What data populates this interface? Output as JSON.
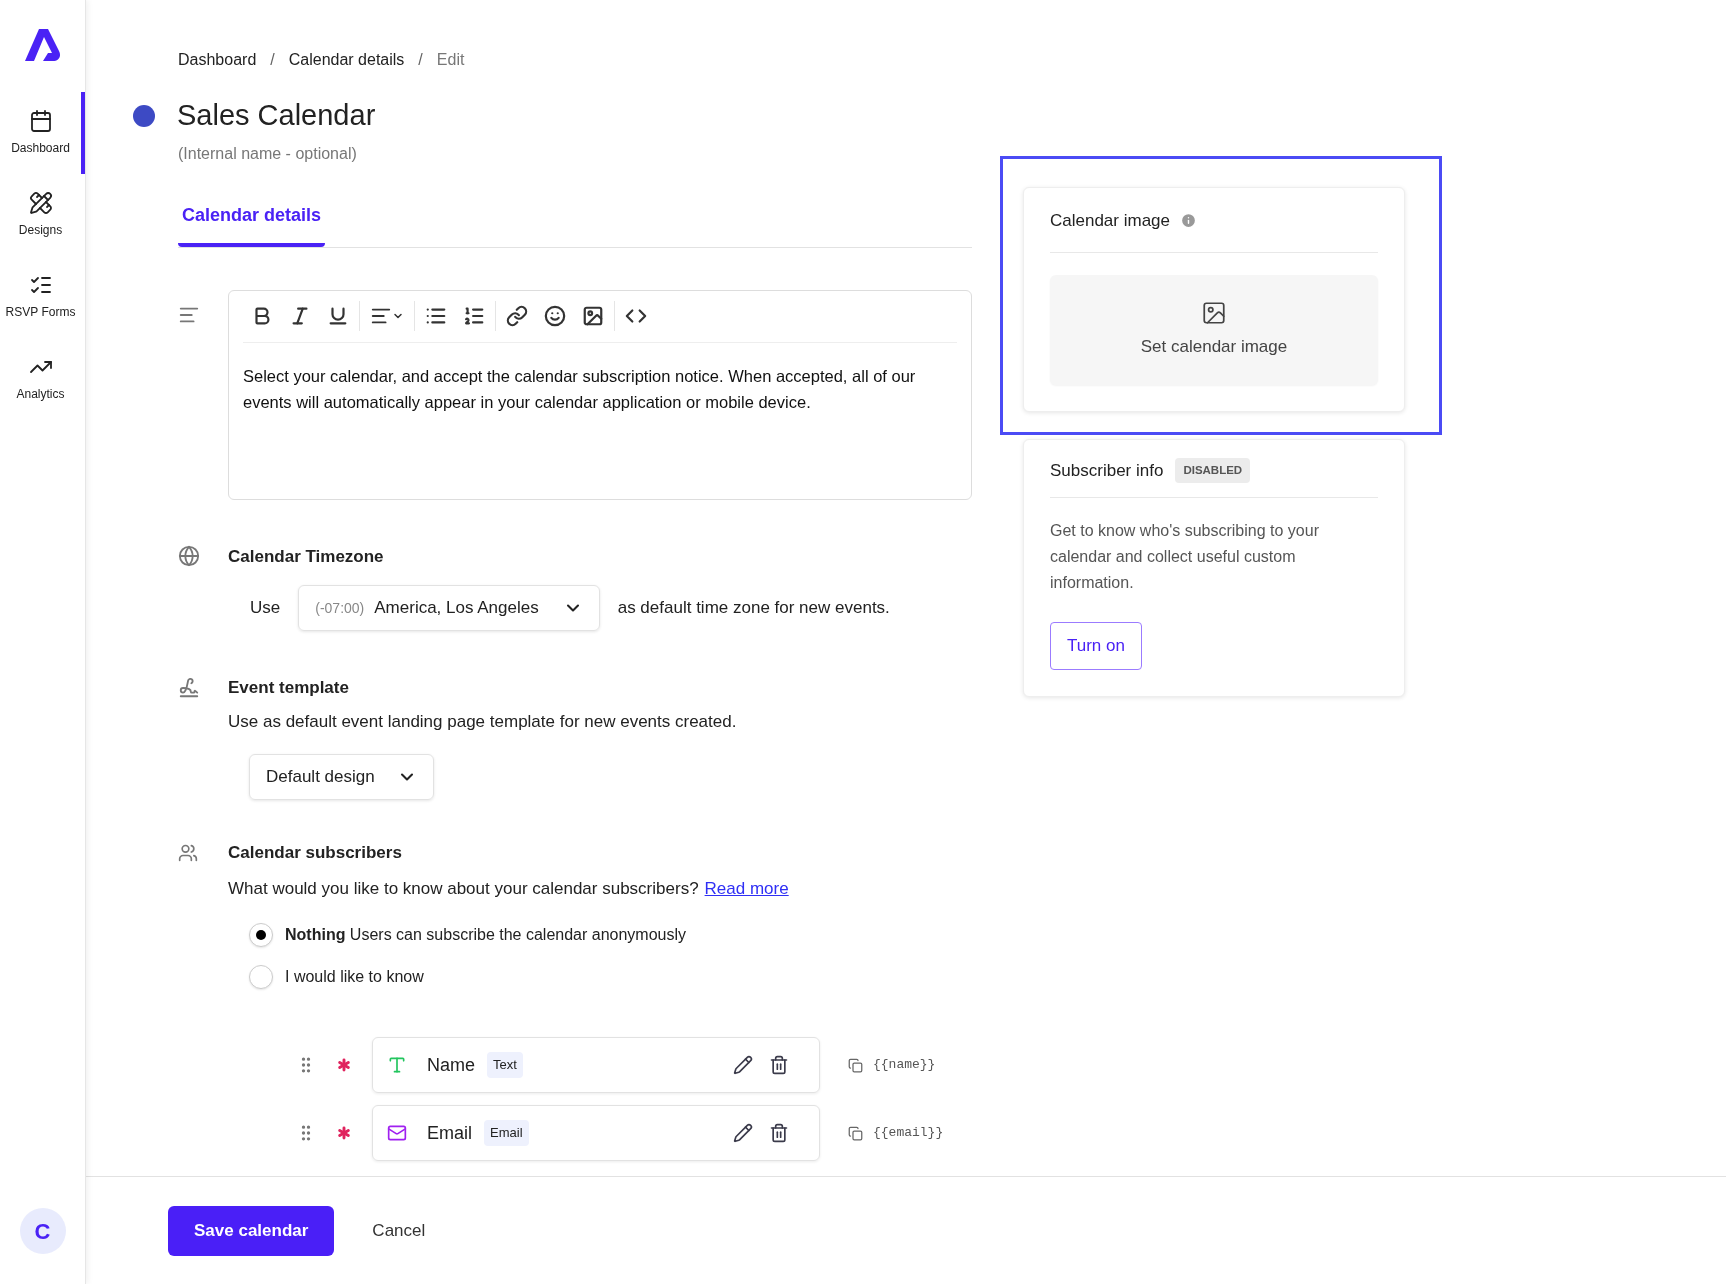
{
  "sidebar": {
    "items": [
      {
        "label": "Dashboard",
        "kind": "calendar",
        "selected": true
      },
      {
        "label": "Designs",
        "kind": "designs",
        "selected": false
      },
      {
        "label": "RSVP Forms",
        "kind": "forms",
        "selected": false
      },
      {
        "label": "Analytics",
        "kind": "analytics",
        "selected": false
      }
    ],
    "avatar": "C"
  },
  "breadcrumb": [
    {
      "label": "Dashboard",
      "current": false
    },
    {
      "label": "Calendar details",
      "current": false
    },
    {
      "label": "Edit",
      "current": true
    }
  ],
  "breadcrumb_separator": "/",
  "calendar": {
    "title": "Sales Calendar",
    "subtitle": "(Internal name - optional)",
    "color": "#3d4ac4"
  },
  "tabs": [
    {
      "label": "Calendar details",
      "selected": true
    }
  ],
  "editor": {
    "body": "Select your calendar, and accept the calendar subscription notice. When accepted, all of our events will automatically appear in your calendar application or mobile device."
  },
  "timezone": {
    "heading": "Calendar Timezone",
    "prefix": "Use",
    "offset": "(-07:00)",
    "value": "America, Los Angeles",
    "suffix": "as default time zone for new events."
  },
  "event_template": {
    "heading": "Event template",
    "description": "Use as default event landing page template for new events created.",
    "value": "Default design"
  },
  "subscribers": {
    "heading": "Calendar subscribers",
    "question": "What would you like to know about your calendar subscribers?",
    "link": "Read more",
    "options": [
      {
        "label": "**Nothing** Users can subscribe the calendar anonymously",
        "selected": true
      },
      {
        "label": "I would like to know",
        "selected": false
      }
    ],
    "fields": [
      {
        "kind": "text",
        "name": "Name",
        "badge": "Text",
        "required": true,
        "token": "{{name}}"
      },
      {
        "kind": "email",
        "name": "Email",
        "badge": "Email",
        "required": true,
        "token": "{{email}}"
      }
    ]
  },
  "calendar_image": {
    "title": "Calendar image",
    "button": "Set calendar image",
    "highlighted": true
  },
  "subscriber_info": {
    "title": "Subscriber info",
    "badge": "DISABLED",
    "text": "Get to know who's subscribing to your calendar and collect useful custom information.",
    "button": "Turn on"
  },
  "footer": {
    "save": "Save calendar",
    "cancel": "Cancel"
  }
}
